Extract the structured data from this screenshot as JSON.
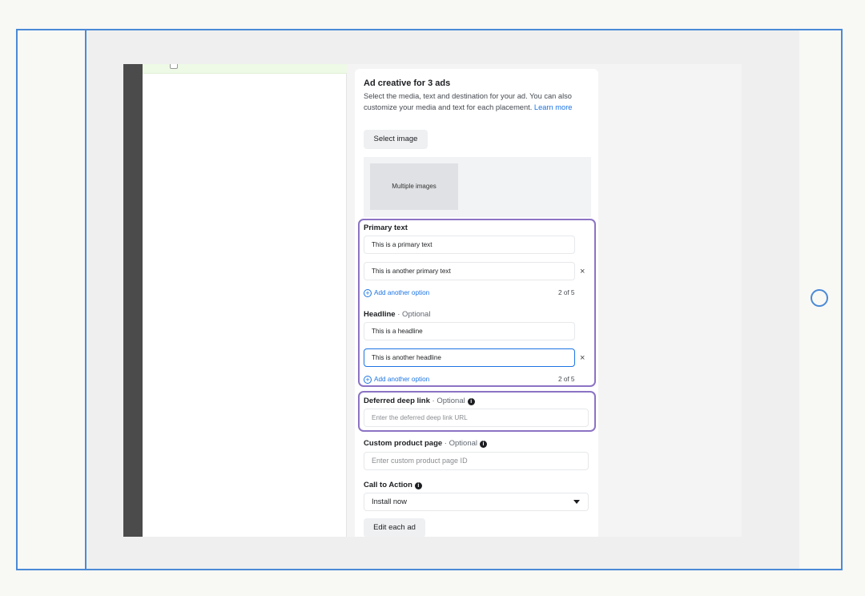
{
  "card": {
    "title": "Ad creative for 3 ads",
    "description": "Select the media, text and destination for your ad. You can also customize your media and text for each placement.",
    "learn_more": "Learn more"
  },
  "media": {
    "select_image_label": "Select image",
    "tile_label": "Multiple images"
  },
  "primary_text": {
    "label": "Primary text",
    "values": [
      "This is a primary text",
      "This is another primary text"
    ],
    "add_option": "Add another option",
    "counter": "2 of 5"
  },
  "headline": {
    "label": "Headline",
    "optional": " · Optional",
    "values": [
      "This is a headline",
      "This is another headline"
    ],
    "add_option": "Add another option",
    "counter": "2 of 5"
  },
  "deep_link": {
    "label": "Deferred deep link",
    "optional": " · Optional",
    "placeholder": "Enter the deferred deep link URL"
  },
  "custom_product_page": {
    "label": "Custom product page",
    "optional": " · Optional",
    "placeholder": "Enter custom product page ID"
  },
  "call_to_action": {
    "label": "Call to Action",
    "selected": "Install now"
  },
  "edit_each_ad_label": "Edit each ad",
  "icons": {
    "remove": "×",
    "info": "i",
    "add": "+"
  },
  "colors": {
    "highlight_outline": "#8b73c4",
    "link_blue": "#1b74e4",
    "frame_blue": "#4a8ad6"
  }
}
